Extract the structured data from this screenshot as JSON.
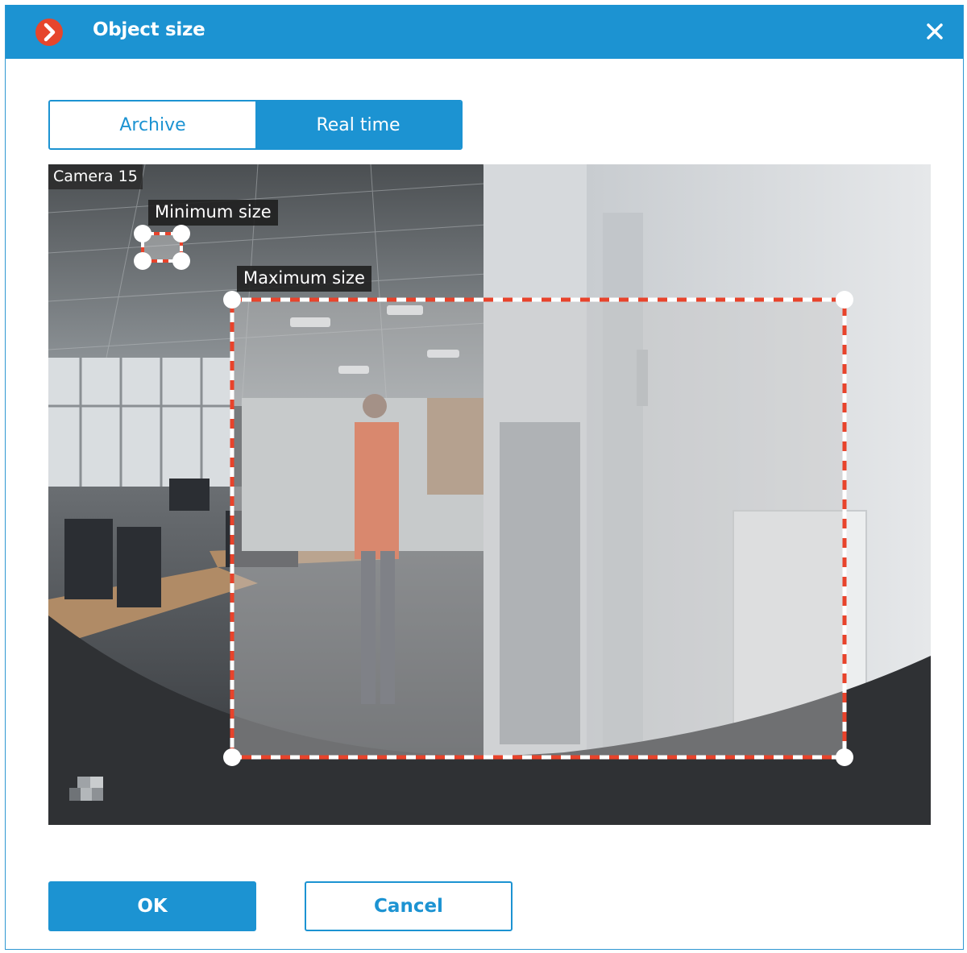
{
  "dialog": {
    "title": "Object size",
    "close_icon": "close-icon",
    "logo_icon": "chevron-right-logo-icon"
  },
  "mode_tabs": {
    "items": [
      {
        "label": "Archive",
        "selected": false
      },
      {
        "label": "Real time",
        "selected": true
      }
    ]
  },
  "video": {
    "camera_name": "Camera 15",
    "min_box_label": "Minimum size",
    "max_box_label": "Maximum size"
  },
  "buttons": {
    "ok_label": "OK",
    "cancel_label": "Cancel"
  },
  "colors": {
    "accent": "#1c93d2",
    "logo": "#e6462c",
    "box_dash": "#e8432b"
  }
}
